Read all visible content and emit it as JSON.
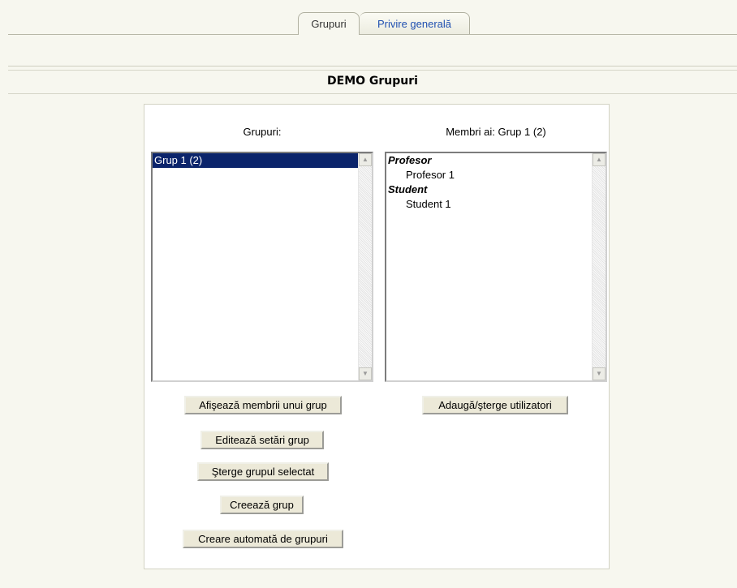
{
  "tabs": [
    {
      "label": "Grupuri",
      "active": true
    },
    {
      "label": "Privire generală",
      "active": false
    }
  ],
  "page_title": "DEMO Grupuri",
  "groups_panel": {
    "label": "Grupuri:",
    "options": [
      {
        "label": "Grup 1 (2)",
        "selected": true
      }
    ]
  },
  "members_panel": {
    "label": "Membri ai: Grup 1 (2)",
    "groups": [
      {
        "role": "Profesor",
        "members": [
          "Profesor 1"
        ]
      },
      {
        "role": "Student",
        "members": [
          "Student 1"
        ]
      }
    ]
  },
  "buttons": {
    "show_members": "Afişează membrii unui grup",
    "edit_group": "Editează setări grup",
    "delete_group": "Şterge grupul selectat",
    "create_group": "Creează grup",
    "auto_create": "Creare automată de grupuri",
    "add_remove_users": "Adaugă/şterge utilizatori"
  },
  "colors": {
    "page_background": "#f7f7ef",
    "selection": "#0b246b",
    "link_tab": "#2050b0"
  },
  "icons": {
    "scroll_up": "triangle-up",
    "scroll_down": "triangle-down"
  }
}
